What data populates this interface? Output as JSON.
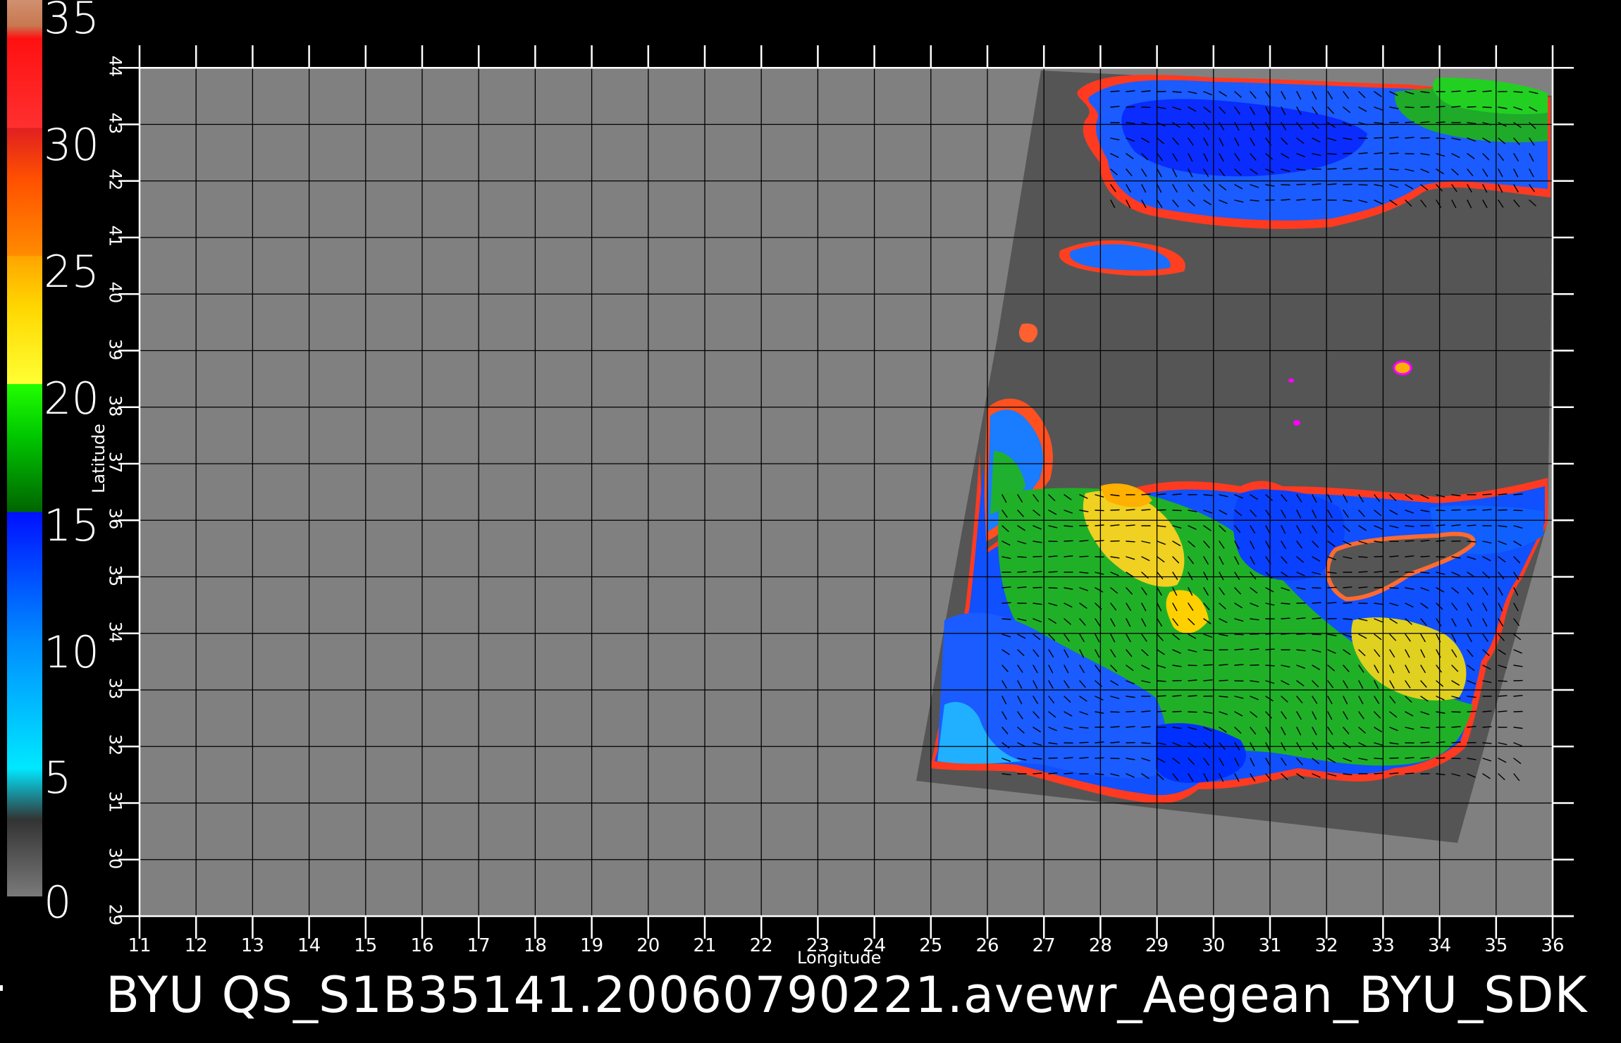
{
  "title": "BYU  QS_S1B35141.20060790221.avewr_Aegean_BYU_SDK",
  "colorbar": {
    "labels": [
      "0",
      "5",
      "10",
      "15",
      "20",
      "25",
      "30",
      "35"
    ],
    "range": [
      0,
      35
    ],
    "stops": [
      {
        "value": 0,
        "color": "#7a7a7a"
      },
      {
        "value": 3,
        "color": "#333333"
      },
      {
        "value": 5,
        "color": "#00e8ff"
      },
      {
        "value": 10,
        "color": "#008cff"
      },
      {
        "value": 15,
        "color": "#0010ff"
      },
      {
        "value": 15.01,
        "color": "#006400"
      },
      {
        "value": 18,
        "color": "#00c800"
      },
      {
        "value": 20,
        "color": "#22ff00"
      },
      {
        "value": 20.01,
        "color": "#ffff33"
      },
      {
        "value": 23,
        "color": "#ffd700"
      },
      {
        "value": 25,
        "color": "#ffa500"
      },
      {
        "value": 25.01,
        "color": "#ff8c00"
      },
      {
        "value": 28,
        "color": "#ff5000"
      },
      {
        "value": 30,
        "color": "#e02020"
      },
      {
        "value": 30.01,
        "color": "#ff3030"
      },
      {
        "value": 33.5,
        "color": "#ff1010"
      },
      {
        "value": 34,
        "color": "#c87850"
      },
      {
        "value": 35,
        "color": "#d09070"
      }
    ]
  },
  "axes": {
    "xlabel": "Longitude",
    "ylabel": "Latitude",
    "xticks": [
      "11",
      "12",
      "13",
      "14",
      "15",
      "16",
      "17",
      "18",
      "19",
      "20",
      "21",
      "22",
      "23",
      "24",
      "25",
      "26",
      "27",
      "28",
      "29",
      "30",
      "31",
      "32",
      "33",
      "34",
      "35",
      "36"
    ],
    "yticks": [
      "29",
      "30",
      "31",
      "32",
      "33",
      "34",
      "35",
      "36",
      "37",
      "38",
      "39",
      "40",
      "41",
      "42",
      "43",
      "44"
    ],
    "xlim": [
      11,
      36
    ],
    "ylim": [
      29,
      44
    ],
    "grid": true
  },
  "colors": {
    "background": "#000000",
    "land_mask": "#808080",
    "swath_no_data": "#555555",
    "grid": "#000000",
    "wind_vectors": "#000000"
  }
}
